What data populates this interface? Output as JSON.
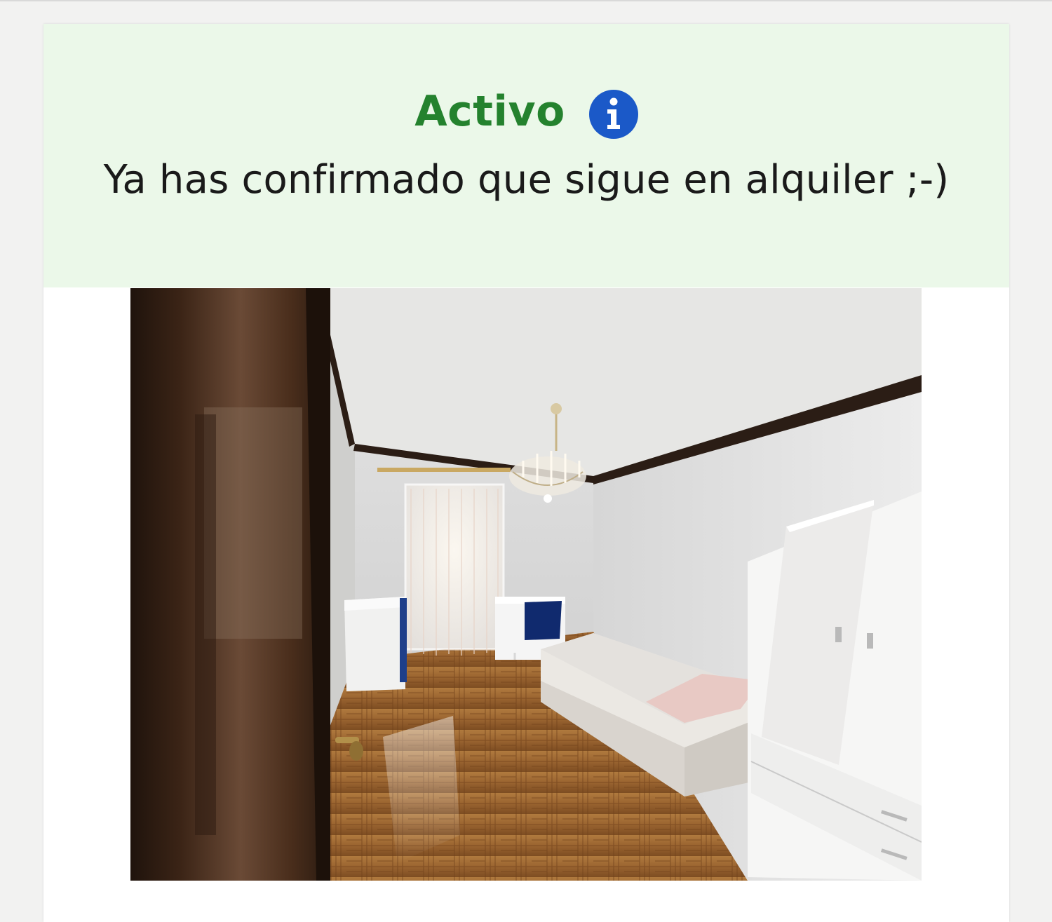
{
  "status": {
    "title": "Activo",
    "title_color": "#24822e",
    "info_icon": "info-circle-icon",
    "info_icon_color": "#1b59c8",
    "message": "Ya has confirmado que sigue en alquiler ;-)",
    "panel_background": "#ebf8e9"
  },
  "listing": {
    "photo_subject": "furnished-bedroom-photo"
  }
}
